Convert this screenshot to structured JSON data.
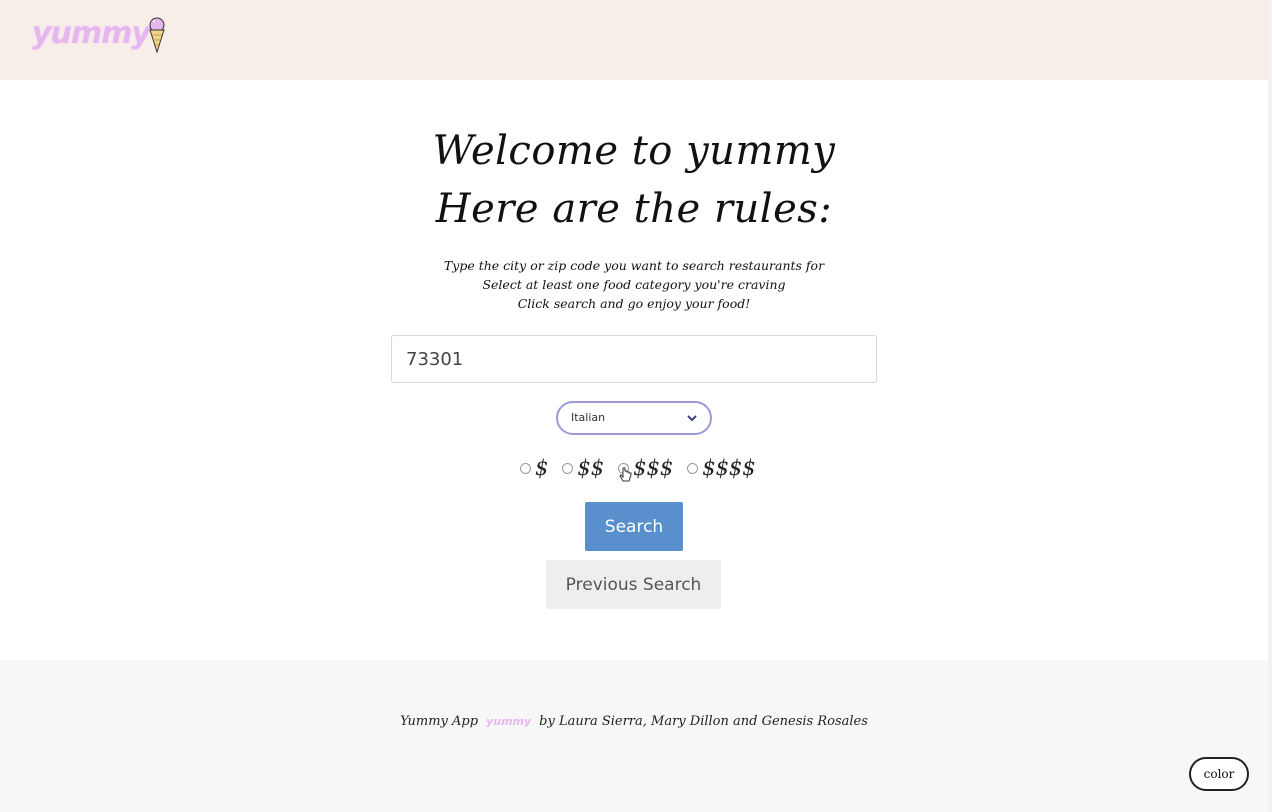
{
  "header": {
    "logo_text": "yummy",
    "logo_icon": "ice-cream-icon"
  },
  "welcome": {
    "title_line1": "Welcome to yummy",
    "title_line2": "Here are the rules:",
    "rules": [
      "Type the city or zip code you want to search restaurants for",
      "Select at least one food category you're craving",
      "Click search and go enjoy your food!"
    ]
  },
  "search": {
    "location_value": "73301",
    "category_selected": "Italian",
    "price_options": [
      "$",
      "$$",
      "$$$",
      "$$$$"
    ],
    "search_button": "Search",
    "previous_button": "Previous Search"
  },
  "footer": {
    "credit_prefix": "Yummy App",
    "credit_logo": "yummy",
    "credit_suffix": "by Laura Sierra, Mary Dillon and Genesis Rosales",
    "color_button": "color"
  },
  "colors": {
    "header_bg": "#f7ede9",
    "logo_pink": "#e6b6ef",
    "search_blue": "#5a8fcd",
    "select_border": "#9a9ad8"
  }
}
